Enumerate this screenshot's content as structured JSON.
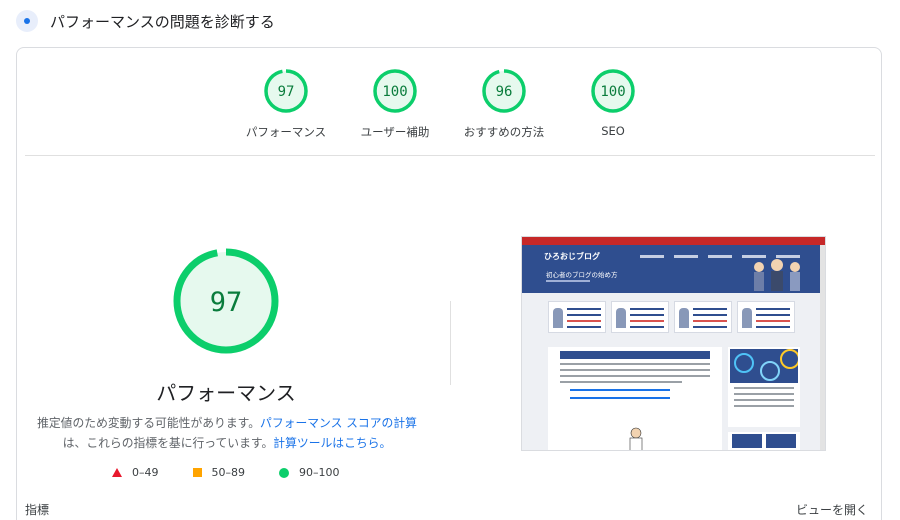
{
  "header": {
    "title": "パフォーマンスの問題を診断する",
    "icon": "lighthouse-icon"
  },
  "categories": [
    {
      "score": "97",
      "label": "パフォーマンス",
      "fraction": 0.97
    },
    {
      "score": "100",
      "label": "ユーザー補助",
      "fraction": 1.0
    },
    {
      "score": "96",
      "label": "おすすめの方法",
      "fraction": 0.96
    },
    {
      "score": "100",
      "label": "SEO",
      "fraction": 1.0
    }
  ],
  "main": {
    "score": "97",
    "fraction": 0.97,
    "title": "パフォーマンス",
    "desc_line1_text": "推定値のため変動する可能性があります。",
    "desc_line1_link": "パフォーマンス スコアの計算",
    "desc_line2_text": "は、これらの指標を基に行っています。",
    "desc_line2_link": "計算ツールはこちら。"
  },
  "legend": [
    {
      "shape": "triangle",
      "range": "0–49",
      "color": "#e8182d"
    },
    {
      "shape": "square",
      "range": "50–89",
      "color": "#ffa400"
    },
    {
      "shape": "circle",
      "range": "90–100",
      "color": "#0cce6b"
    }
  ],
  "screenshot": {
    "site_logo": "ひろおじブログ",
    "hero_title": "初心者のブログの始め方"
  },
  "footer": {
    "metrics_label": "指標",
    "view_toggle": "ビューを開く"
  },
  "colors": {
    "pass": "#0cce6b",
    "pass_text": "#0a7c3c",
    "pass_bg": "#e6f9ee",
    "link": "#1a73e8"
  }
}
